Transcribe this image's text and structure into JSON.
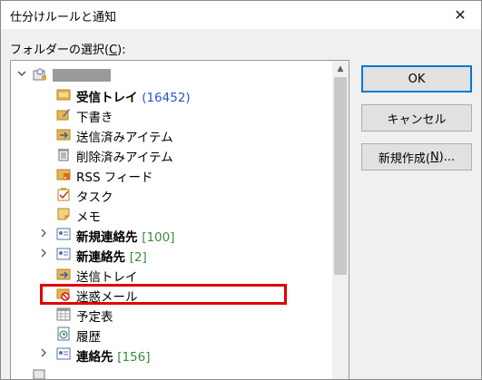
{
  "dialog": {
    "title": "仕分けルールと通知",
    "close_glyph": "✕",
    "folder_label_prefix": "フォルダーの選択(",
    "folder_label_key": "C",
    "folder_label_suffix": "):"
  },
  "buttons": {
    "ok": "OK",
    "cancel": "キャンセル",
    "new_prefix": "新規作成(",
    "new_key": "N",
    "new_suffix": ")..."
  },
  "tree": {
    "items": [
      {
        "label": "受信トレイ",
        "count": "(16452)"
      },
      {
        "label": "下書き"
      },
      {
        "label": "送信済みアイテム"
      },
      {
        "label": "削除済みアイテム"
      },
      {
        "label": "RSS フィード"
      },
      {
        "label": "タスク"
      },
      {
        "label": "メモ"
      },
      {
        "label": "新規連絡先",
        "count": "[100]"
      },
      {
        "label": "新連絡先",
        "count": "[2]"
      },
      {
        "label": "送信トレイ"
      },
      {
        "label": "迷惑メール"
      },
      {
        "label": "予定表"
      },
      {
        "label": "履歴"
      },
      {
        "label": "連絡先",
        "count": "[156]"
      }
    ]
  },
  "colors": {
    "highlight": "#e00000",
    "count_blue": "#2b55c8",
    "count_green": "#3a8a3a",
    "default_button_border": "#0078d7"
  }
}
